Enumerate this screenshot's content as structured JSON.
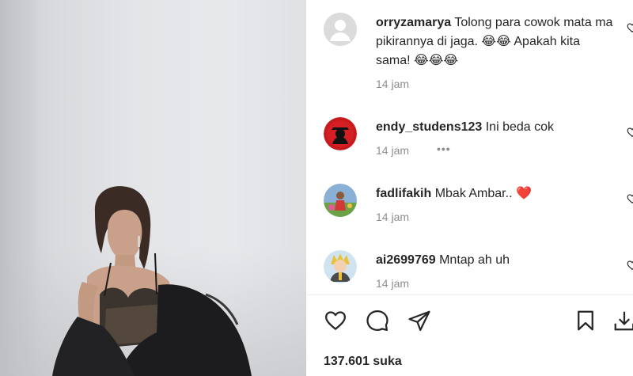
{
  "post": {
    "likes_text": "137.601 suka"
  },
  "comments": [
    {
      "username": "orryzamarya",
      "text": "Tolong para cowok mata ma pikirannya di jaga. 😂😂 Apakah kita sama! 😂😂😂",
      "time": "14 jam",
      "avatar": "default-avatar-icon"
    },
    {
      "username": "endy_studens123",
      "text": "Ini beda cok",
      "time": "14 jam",
      "more": "•••",
      "avatar": "red-silhouette-avatar"
    },
    {
      "username": "fadlifakih",
      "text": "Mbak Ambar.. ❤️",
      "time": "14 jam",
      "avatar": "photo-avatar"
    },
    {
      "username": "ai2699769",
      "text": "Mntap ah uh",
      "time": "14 jam",
      "avatar": "anime-avatar"
    }
  ],
  "actions": [
    "heart-icon",
    "comment-icon",
    "share-icon",
    "bookmark-icon",
    "download-icon"
  ],
  "colors": {
    "text": "#262626",
    "secondary": "#8e8e8e",
    "heart": "#ed4956",
    "divider": "#efefef"
  }
}
